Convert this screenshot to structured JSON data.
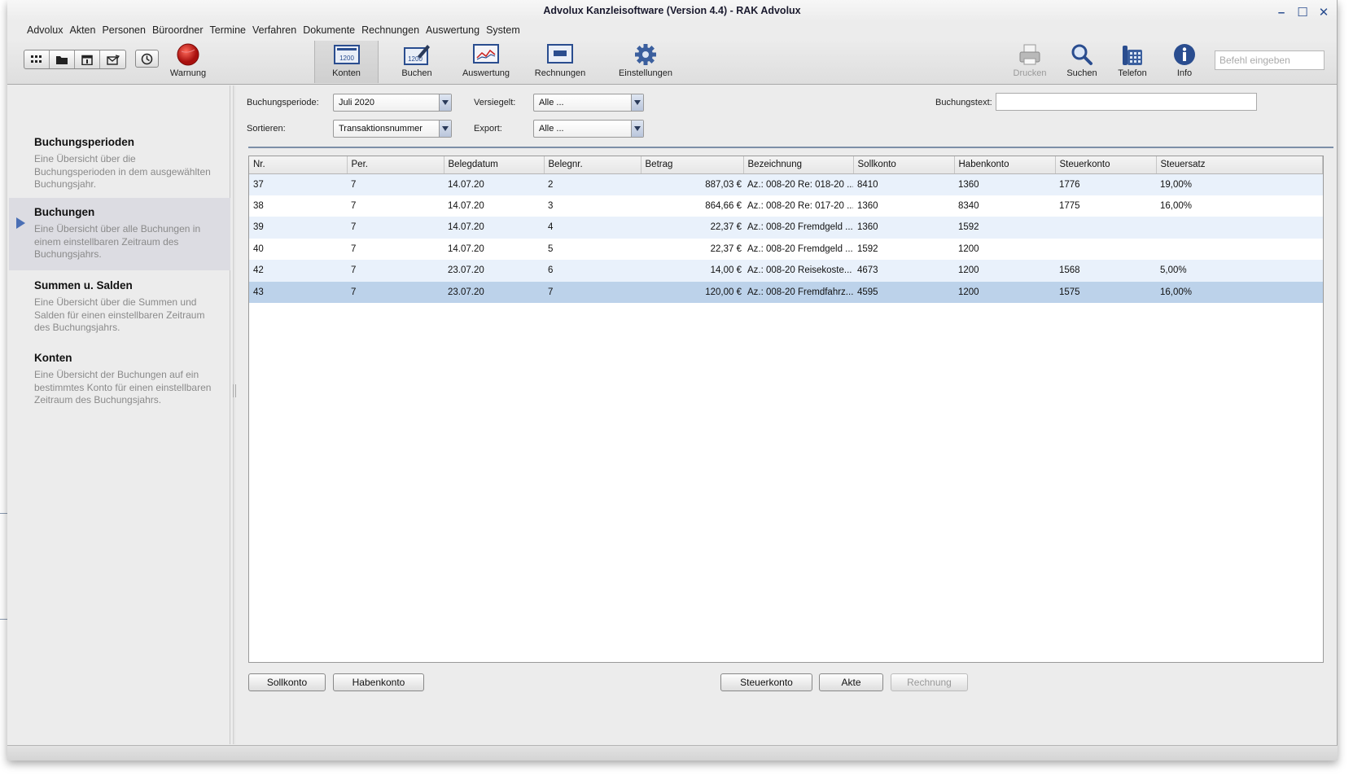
{
  "window": {
    "title": "Advolux Kanzleisoftware (Version 4.4) - RAK Advolux",
    "controls": [
      "–",
      "☐",
      "✕"
    ]
  },
  "menu": [
    "Advolux",
    "Akten",
    "Personen",
    "Büroordner",
    "Termine",
    "Verfahren",
    "Dokumente",
    "Rechnungen",
    "Auswertung",
    "System"
  ],
  "toolbar": {
    "warning_label": "Warnung",
    "buttons": {
      "konten": "Konten",
      "buchen": "Buchen",
      "auswertung": "Auswertung",
      "rechnungen": "Rechnungen",
      "einstellungen": "Einstellungen",
      "drucken": "Drucken",
      "suchen": "Suchen",
      "telefon": "Telefon",
      "info": "Info"
    },
    "command_placeholder": "Befehl eingeben",
    "icon_value": "1200",
    "active": "Konten",
    "disabled": [
      "Drucken"
    ]
  },
  "sidebar": {
    "items": [
      {
        "title": "Buchungsperioden",
        "desc": "Eine Übersicht über die Buchungsperioden in dem ausgewählten Buchungsjahr."
      },
      {
        "title": "Buchungen",
        "desc": "Eine Übersicht über alle Buchungen in einem einstellbaren Zeitraum des Buchungsjahrs."
      },
      {
        "title": "Summen u. Salden",
        "desc": "Eine Übersicht über die Summen und Salden für einen einstellbaren Zeitraum des Buchungsjahrs."
      },
      {
        "title": "Konten",
        "desc": "Eine Übersicht der Buchungen auf ein bestimmtes Konto für einen einstellbaren Zeitraum des Buchungsjahrs."
      }
    ],
    "active": "Buchungen"
  },
  "filters": {
    "buchungsperiode_label": "Buchungsperiode:",
    "buchungsperiode_value": "Juli 2020",
    "sortieren_label": "Sortieren:",
    "sortieren_value": "Transaktionsnummer",
    "versiegelt_label": "Versiegelt:",
    "versiegelt_value": "Alle ...",
    "export_label": "Export:",
    "export_value": "Alle ...",
    "buchungstext_label": "Buchungstext:",
    "buchungstext_value": ""
  },
  "table": {
    "columns": [
      "Nr.",
      "Per.",
      "Belegdatum",
      "Belegnr.",
      "Betrag",
      "Bezeichnung",
      "Sollkonto",
      "Habenkonto",
      "Steuerkonto",
      "Steuersatz"
    ],
    "rows": [
      [
        "37",
        "7",
        "14.07.20",
        "2",
        "887,03 €",
        "Az.: 008-20 Re: 018-20 ...",
        "8410",
        "1360",
        "1776",
        "19,00%"
      ],
      [
        "38",
        "7",
        "14.07.20",
        "3",
        "864,66 €",
        "Az.: 008-20 Re: 017-20 ...",
        "1360",
        "8340",
        "1775",
        "16,00%"
      ],
      [
        "39",
        "7",
        "14.07.20",
        "4",
        "22,37 €",
        "Az.: 008-20 Fremdgeld ...",
        "1360",
        "1592",
        "",
        ""
      ],
      [
        "40",
        "7",
        "14.07.20",
        "5",
        "22,37 €",
        "Az.: 008-20 Fremdgeld ...",
        "1592",
        "1200",
        "",
        ""
      ],
      [
        "42",
        "7",
        "23.07.20",
        "6",
        "14,00 €",
        "Az.: 008-20 Reisekoste...",
        "4673",
        "1200",
        "1568",
        "5,00%"
      ],
      [
        "43",
        "7",
        "23.07.20",
        "7",
        "120,00 €",
        "Az.: 008-20 Fremdfahrz...",
        "4595",
        "1200",
        "1575",
        "16,00%"
      ]
    ],
    "selected_row": 5
  },
  "actions": {
    "sollkonto": "Sollkonto",
    "habenkonto": "Habenkonto",
    "steuerkonto": "Steuerkonto",
    "akte": "Akte",
    "rechnung": "Rechnung"
  },
  "colors": {
    "accent": "#4a6fb5",
    "selected_row": "#bcd2ea",
    "alt_row": "#e9f1fb",
    "warning_red": "#c8201e"
  }
}
